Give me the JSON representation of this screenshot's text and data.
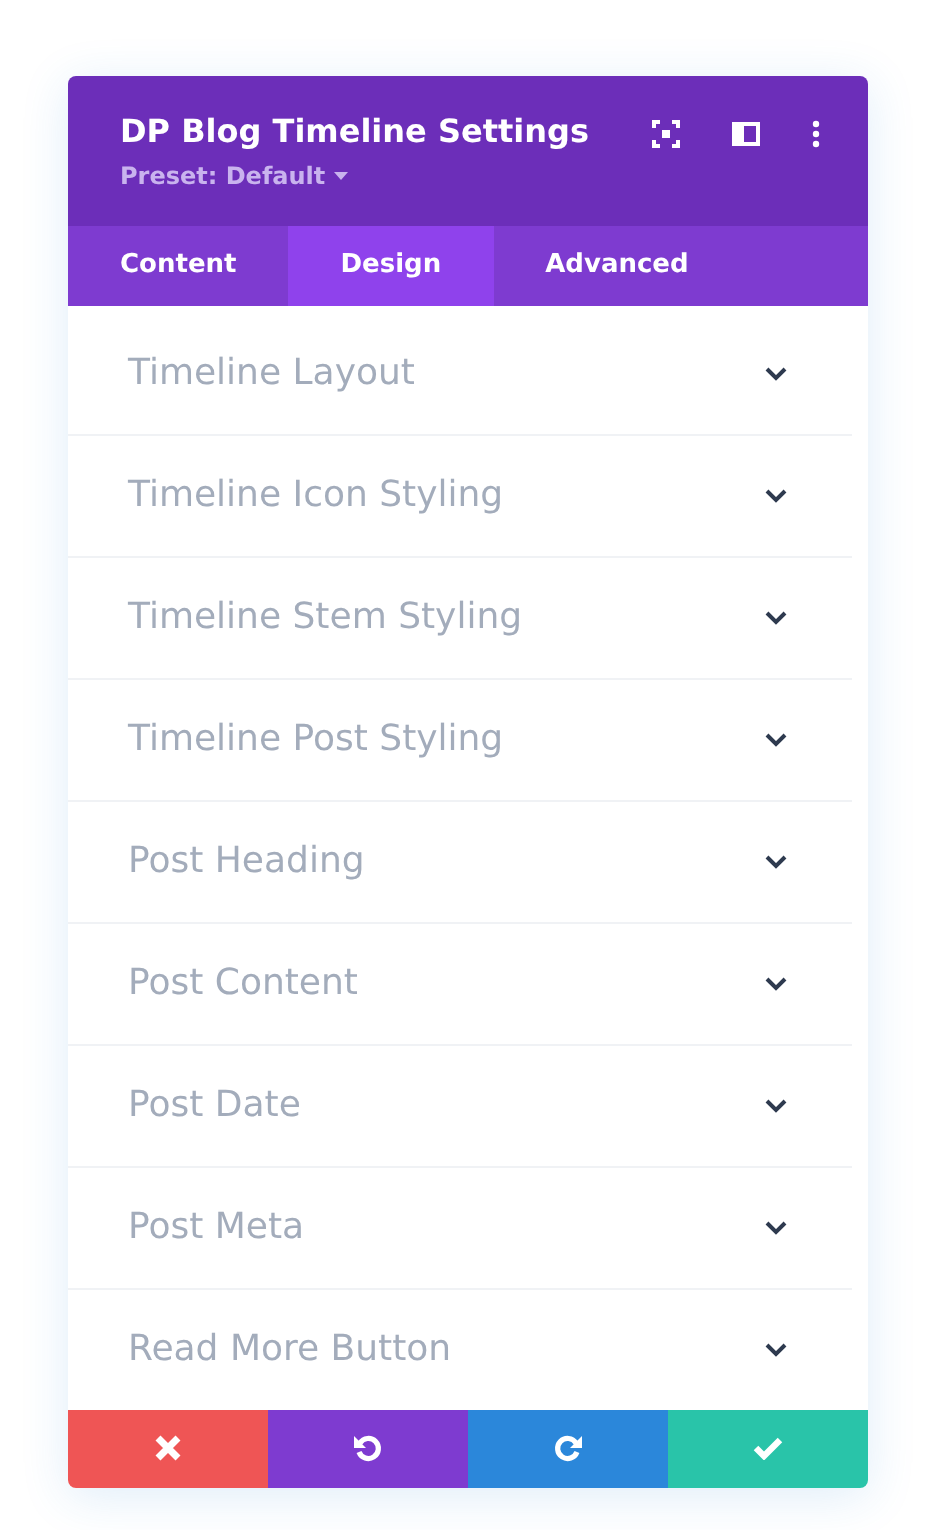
{
  "window": {
    "title": "DP Blog Timeline Settings",
    "preset": "Preset: Default"
  },
  "tabs": [
    {
      "label": "Content",
      "selected": false
    },
    {
      "label": "Design",
      "selected": true
    },
    {
      "label": "Advanced",
      "selected": false
    }
  ],
  "sections": [
    {
      "label": "Timeline Layout",
      "expanded": false
    },
    {
      "label": "Timeline Icon Styling",
      "expanded": false
    },
    {
      "label": "Timeline Stem Styling",
      "expanded": false
    },
    {
      "label": "Timeline Post Styling",
      "expanded": false
    },
    {
      "label": "Post Heading",
      "expanded": false
    },
    {
      "label": "Post Content",
      "expanded": false
    },
    {
      "label": "Post Date",
      "expanded": false
    },
    {
      "label": "Post Meta",
      "expanded": false
    },
    {
      "label": "Read More Button",
      "expanded": false
    }
  ],
  "footer_buttons": [
    {
      "kind": "cancel"
    },
    {
      "kind": "undo"
    },
    {
      "kind": "redo"
    },
    {
      "kind": "save"
    }
  ]
}
